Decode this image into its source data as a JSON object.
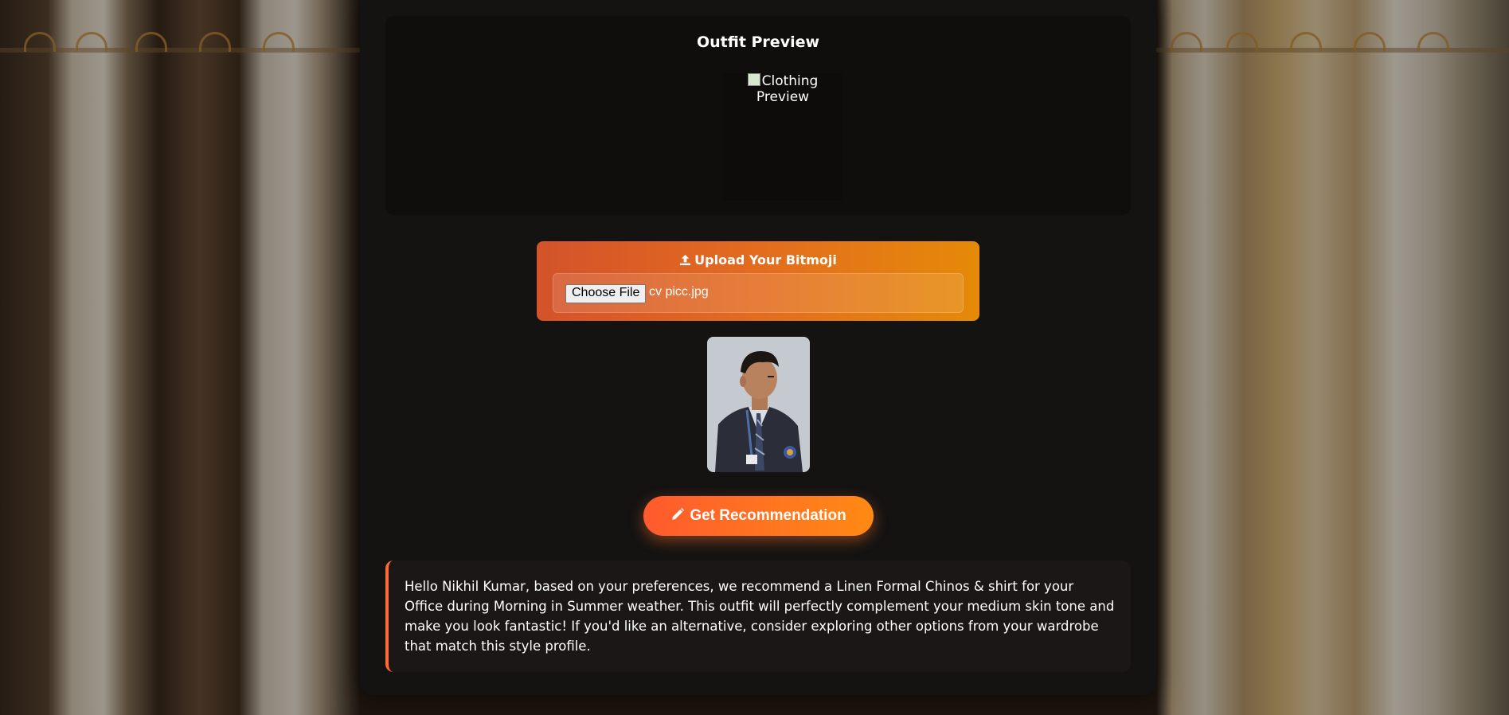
{
  "preview": {
    "title": "Outfit Preview",
    "image_alt": "Clothing Preview"
  },
  "upload": {
    "icon": "upload-icon",
    "title": "Upload Your Bitmoji",
    "choose_label": "Choose File",
    "file_name": "cv picc.jpg"
  },
  "avatar": {
    "description": "uploaded-photo"
  },
  "recommend": {
    "icon": "pencil-icon",
    "label": "Get Recommendation"
  },
  "result": {
    "text": "Hello Nikhil Kumar, based on your preferences, we recommend a Linen Formal Chinos & shirt for your Office during Morning in Summer weather. This outfit will perfectly complement your medium skin tone and make you look fantastic! If you'd like an alternative, consider exploring other options from your wardrobe that match this style profile."
  },
  "colors": {
    "accent_start": "#ff5a2e",
    "accent_end": "#ff8a14",
    "panel_bg": "#141312"
  }
}
